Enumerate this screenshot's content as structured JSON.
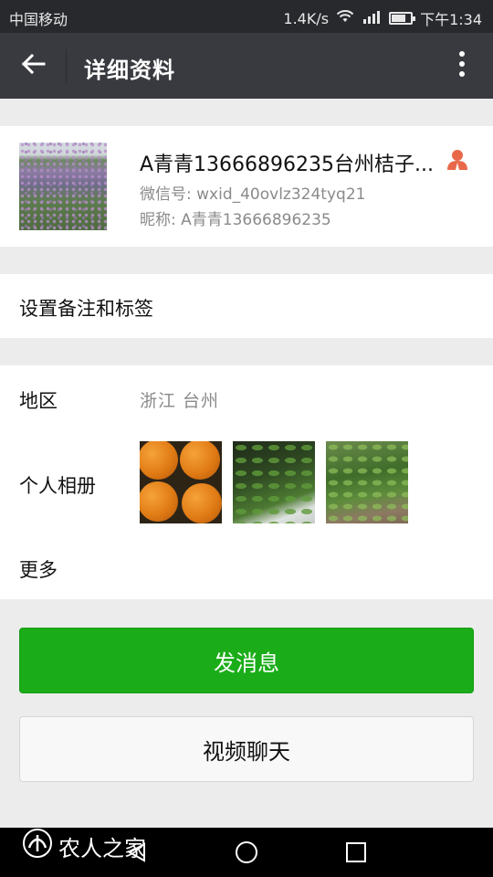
{
  "status_bar": {
    "carrier": "中国移动",
    "speed": "1.4K/s",
    "time": "下午1:34",
    "icons": [
      "wifi-icon",
      "signal-icon",
      "battery-icon"
    ]
  },
  "title_bar": {
    "title": "详细资料",
    "back_icon": "arrow-left-icon",
    "more_icon": "more-vertical-icon"
  },
  "profile": {
    "name": "A青青13666896235台州桔子...",
    "wechat_id": "微信号: wxid_40ovlz324tyq21",
    "nickname": "昵称: A青青13666896235",
    "contact_icon": "contact-person-icon"
  },
  "remark": {
    "label": "设置备注和标签"
  },
  "info": {
    "region_label": "地区",
    "region_value": "浙江  台州",
    "album_label": "个人相册",
    "album_photos": [
      "photo-oranges",
      "photo-plant-seedlings",
      "photo-orange-tree"
    ],
    "more_label": "更多"
  },
  "actions": {
    "send_message": "发消息",
    "video_chat": "视频聊天"
  },
  "watermark": {
    "text": "农人之家"
  },
  "colors": {
    "primary_green": "#1aad19",
    "title_bar": "#393a3f",
    "status_bar": "#27292d",
    "background": "#ececec",
    "contact_icon": "#e8694a"
  }
}
